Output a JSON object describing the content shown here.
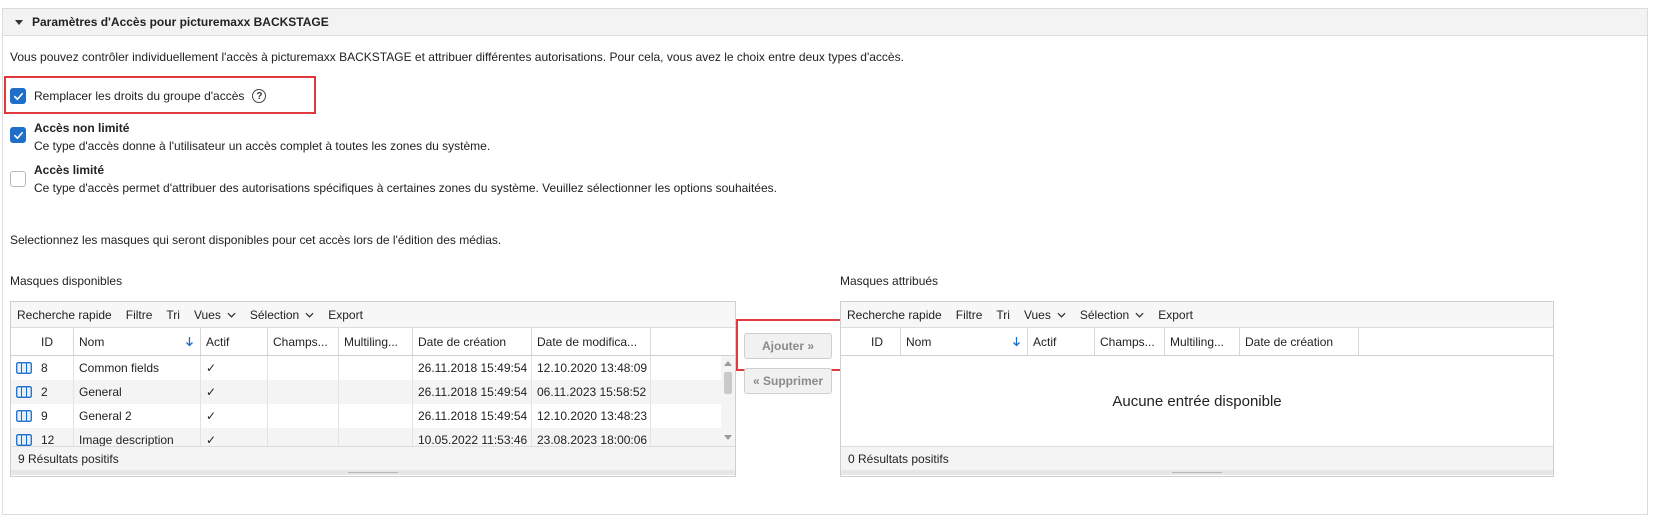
{
  "panel": {
    "title": "Paramètres d'Accès pour picturemaxx BACKSTAGE",
    "intro": "Vous pouvez contrôler individuellement l'accès à picturemaxx BACKSTAGE et attribuer différentes autorisations. Pour cela, vous avez le choix entre deux types d'accès.",
    "override_label": "Remplacer les droits du groupe d'accès",
    "help_glyph": "?",
    "unlimited": {
      "title": "Accès non limité",
      "description": "Ce type d'accès donne à l'utilisateur un accès complet à toutes les zones du système.",
      "checked": true
    },
    "limited": {
      "title": "Accès limité",
      "description": "Ce type d'accès permet d'attribuer des autorisations spécifiques à certaines zones du système. Veuillez sélectionner les options souhaitées.",
      "checked": false
    },
    "masks_hint": "Selectionnez les masques qui seront disponibles pour cet accès lors de l'édition des médias."
  },
  "toolbar": {
    "quick_search": "Recherche rapide",
    "filter": "Filtre",
    "sort": "Tri",
    "views": "Vues",
    "selection": "Sélection",
    "export": "Export"
  },
  "available": {
    "label": "Masques disponibles",
    "columns": [
      "ID",
      "Nom",
      "Actif",
      "Champs...",
      "Multiling...",
      "Date de création",
      "Date de modifica..."
    ],
    "rows": [
      {
        "id": "8",
        "name": "Common fields",
        "active": "✓",
        "created": "26.11.2018 15:49:54",
        "modified": "12.10.2020 13:48:09"
      },
      {
        "id": "2",
        "name": "General",
        "active": "✓",
        "created": "26.11.2018 15:49:54",
        "modified": "06.11.2023 15:58:52"
      },
      {
        "id": "9",
        "name": "General 2",
        "active": "✓",
        "created": "26.11.2018 15:49:54",
        "modified": "12.10.2020 13:48:23"
      },
      {
        "id": "12",
        "name": "Image description",
        "active": "✓",
        "created": "10.05.2022 11:53:46",
        "modified": "23.08.2023 18:00:06"
      }
    ],
    "footer": "9 Résultats positifs"
  },
  "buttons": {
    "add": "Ajouter »",
    "remove": "« Supprimer"
  },
  "assigned": {
    "label": "Masques attribués",
    "columns": [
      "ID",
      "Nom",
      "Actif",
      "Champs...",
      "Multiling...",
      "Date de création"
    ],
    "empty": "Aucune entrée disponible",
    "footer": "0 Résultats positifs"
  },
  "colors": {
    "accent": "#1f6ec9",
    "highlight": "#e0393e"
  },
  "icons": {
    "collapse": "triangle-down-icon",
    "help": "help-circle-icon",
    "sort_arrow": "arrow-down-icon",
    "mask": "mask-grid-icon",
    "dropdown": "chevron-down-icon"
  }
}
